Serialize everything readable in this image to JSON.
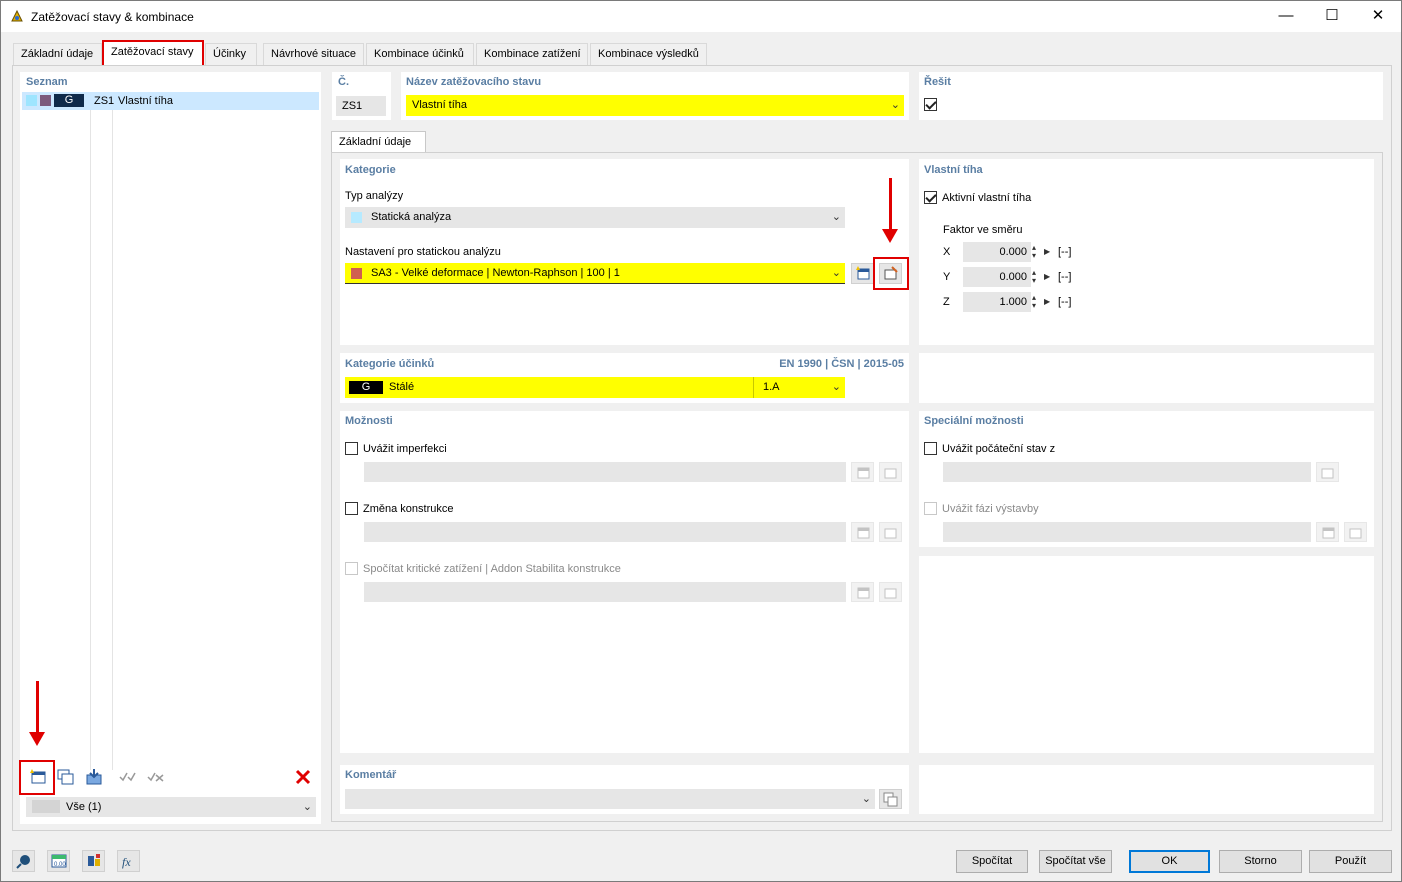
{
  "window": {
    "title": "Zatěžovací stavy & kombinace",
    "minimize": "—",
    "maximize": "☐",
    "close": "✕"
  },
  "tabs": [
    "Základní údaje",
    "Zatěžovací stavy",
    "Účinky",
    "Návrhové situace",
    "Kombinace účinků",
    "Kombinace zatížení",
    "Kombinace výsledků"
  ],
  "list": {
    "title": "Seznam",
    "row": {
      "cat": "G",
      "id": "ZS1",
      "name": "Vlastní tíha"
    },
    "filter": "Vše (1)"
  },
  "header": {
    "no_label": "Č.",
    "no_value": "ZS1",
    "name_label": "Název zatěžovacího stavu",
    "name_value": "Vlastní tíha",
    "solve_label": "Řešit"
  },
  "subtab": "Základní údaje",
  "kategorie": {
    "title": "Kategorie",
    "type_label": "Typ analýzy",
    "type_value": "Statická analýza",
    "settings_label": "Nastavení pro statickou analýzu",
    "settings_value": "SA3 - Velké deformace | Newton-Raphson | 100 | 1"
  },
  "vlastni": {
    "title": "Vlastní tíha",
    "active_label": "Aktivní vlastní tíha",
    "factor_label": "Faktor ve směru",
    "rows": [
      {
        "axis": "X",
        "value": "0.000",
        "unit": "[--]"
      },
      {
        "axis": "Y",
        "value": "0.000",
        "unit": "[--]"
      },
      {
        "axis": "Z",
        "value": "1.000",
        "unit": "[--]"
      }
    ]
  },
  "ucinky": {
    "title": "Kategorie účinků",
    "norm": "EN 1990 | ČSN | 2015-05",
    "code": "G",
    "name": "Stálé",
    "sub": "1.A"
  },
  "moznosti": {
    "title": "Možnosti",
    "imperf": "Uvážit imperfekci",
    "zmena": "Změna konstrukce",
    "krit": "Spočítat kritické zatížení | Addon Stabilita konstrukce"
  },
  "special": {
    "title": "Speciální možnosti",
    "initial": "Uvážit počáteční stav z",
    "phase": "Uvážit fázi výstavby"
  },
  "komentar": {
    "title": "Komentář"
  },
  "buttons": {
    "calc": "Spočítat",
    "calc_all": "Spočítat vše",
    "ok": "OK",
    "cancel": "Storno",
    "apply": "Použít"
  },
  "colors": {
    "highlight": "#ffff00",
    "section_title": "#5a7ea3",
    "annotation": "#e00000",
    "selected_row": "#cce8ff"
  }
}
